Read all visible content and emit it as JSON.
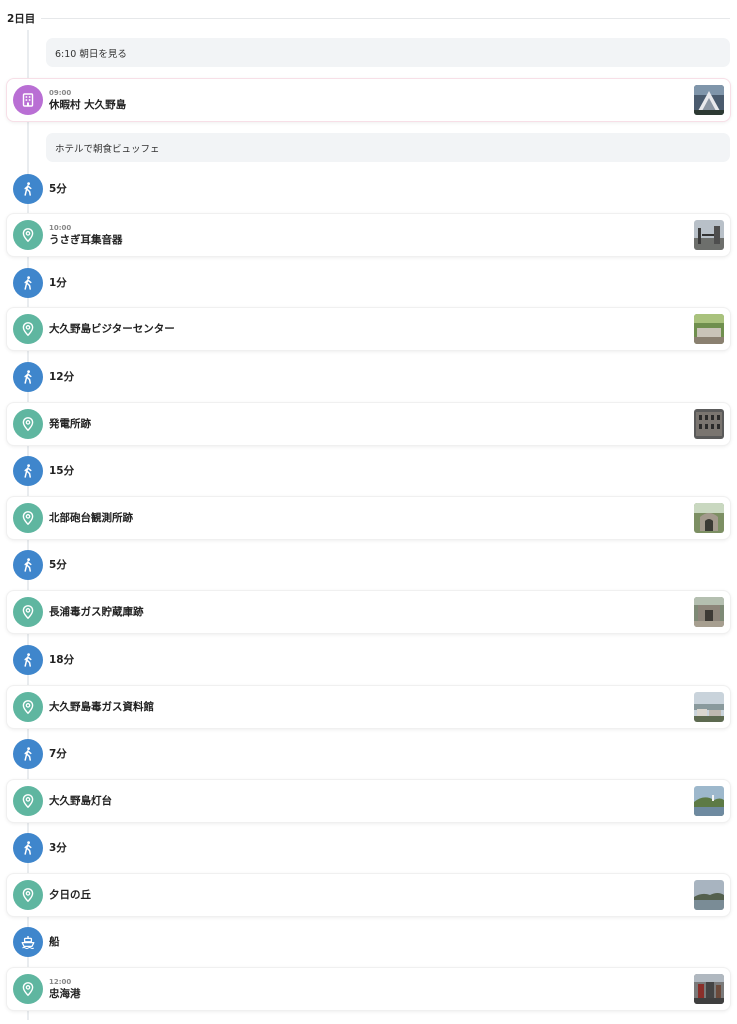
{
  "day": {
    "label": "2日目"
  },
  "colors": {
    "hotel": "#b96fd4",
    "spot": "#5fb6a0",
    "transport": "#3f86cc"
  },
  "items": [
    {
      "kind": "note",
      "text": "6:10 朝日を見る"
    },
    {
      "kind": "hotel",
      "icon": "hotel-icon",
      "time": "09:00",
      "name": "休暇村 大久野島",
      "thumb": "hotel-photo"
    },
    {
      "kind": "note",
      "text": "ホテルで朝食ビュッフェ"
    },
    {
      "kind": "walk",
      "icon": "walking-icon",
      "label": "5分"
    },
    {
      "kind": "spot",
      "icon": "location-pin-icon",
      "time": "10:00",
      "name": "うさぎ耳集音器",
      "thumb": "spot-photo"
    },
    {
      "kind": "walk",
      "icon": "walking-icon",
      "label": "1分"
    },
    {
      "kind": "spot",
      "icon": "location-pin-icon",
      "name": "大久野島ビジターセンター",
      "thumb": "spot-photo"
    },
    {
      "kind": "walk",
      "icon": "walking-icon",
      "label": "12分"
    },
    {
      "kind": "spot",
      "icon": "location-pin-icon",
      "name": "発電所跡",
      "thumb": "spot-photo"
    },
    {
      "kind": "walk",
      "icon": "walking-icon",
      "label": "15分"
    },
    {
      "kind": "spot",
      "icon": "location-pin-icon",
      "name": "北部砲台観測所跡",
      "thumb": "spot-photo"
    },
    {
      "kind": "walk",
      "icon": "walking-icon",
      "label": "5分"
    },
    {
      "kind": "spot",
      "icon": "location-pin-icon",
      "name": "長浦毒ガス貯蔵庫跡",
      "thumb": "spot-photo"
    },
    {
      "kind": "walk",
      "icon": "walking-icon",
      "label": "18分"
    },
    {
      "kind": "spot",
      "icon": "location-pin-icon",
      "name": "大久野島毒ガス資料館",
      "thumb": "spot-photo"
    },
    {
      "kind": "walk",
      "icon": "walking-icon",
      "label": "7分"
    },
    {
      "kind": "spot",
      "icon": "location-pin-icon",
      "name": "大久野島灯台",
      "thumb": "spot-photo"
    },
    {
      "kind": "walk",
      "icon": "walking-icon",
      "label": "3分"
    },
    {
      "kind": "spot",
      "icon": "location-pin-icon",
      "name": "夕日の丘",
      "thumb": "spot-photo"
    },
    {
      "kind": "boat",
      "icon": "ship-icon",
      "label": "船"
    },
    {
      "kind": "spot",
      "icon": "location-pin-icon",
      "time": "12:00",
      "name": "忠海港",
      "thumb": "spot-photo"
    }
  ]
}
